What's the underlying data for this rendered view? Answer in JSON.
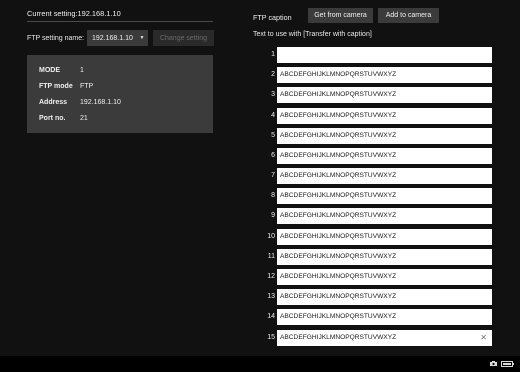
{
  "left_panel": {
    "current_setting": "Current setting:192.168.1.10",
    "setting_label": "FTP setting name:",
    "setting_select": "192.168.1.10",
    "change_button": "Change setting",
    "info": [
      {
        "key": "MODE",
        "value": "1"
      },
      {
        "key": "FTP mode",
        "value": "FTP"
      },
      {
        "key": "Address",
        "value": "192.168.1.10"
      },
      {
        "key": "Port no.",
        "value": "21"
      }
    ]
  },
  "right_panel": {
    "caption_label": "FTP caption",
    "get_button": "Get from camera",
    "add_button": "Add to camera",
    "text_use_label": "Text to use with [Transfer with caption]",
    "captions": [
      {
        "num": "1",
        "value": ""
      },
      {
        "num": "2",
        "value": "ABCDEFGHIJKLMNOPQRSTUVWXYZ"
      },
      {
        "num": "3",
        "value": "ABCDEFGHIJKLMNOPQRSTUVWXYZ"
      },
      {
        "num": "4",
        "value": "ABCDEFGHIJKLMNOPQRSTUVWXYZ"
      },
      {
        "num": "5",
        "value": "ABCDEFGHIJKLMNOPQRSTUVWXYZ"
      },
      {
        "num": "6",
        "value": "ABCDEFGHIJKLMNOPQRSTUVWXYZ"
      },
      {
        "num": "7",
        "value": "ABCDEFGHIJKLMNOPQRSTUVWXYZ"
      },
      {
        "num": "8",
        "value": "ABCDEFGHIJKLMNOPQRSTUVWXYZ"
      },
      {
        "num": "9",
        "value": "ABCDEFGHIJKLMNOPQRSTUVWXYZ"
      },
      {
        "num": "10",
        "value": "ABCDEFGHIJKLMNOPQRSTUVWXYZ"
      },
      {
        "num": "11",
        "value": "ABCDEFGHIJKLMNOPQRSTUVWXYZ"
      },
      {
        "num": "12",
        "value": "ABCDEFGHIJKLMNOPQRSTUVWXYZ"
      },
      {
        "num": "13",
        "value": "ABCDEFGHIJKLMNOPQRSTUVWXYZ"
      },
      {
        "num": "14",
        "value": "ABCDEFGHIJKLMNOPQRSTUVWXYZ"
      },
      {
        "num": "15",
        "value": "ABCDEFGHIJKLMNOPQRSTUVWXYZ"
      }
    ]
  },
  "footer": {
    "icons": [
      "camera-icon",
      "battery-icon"
    ]
  },
  "colors": {
    "background": "#111111",
    "panel": "#3b3b3b",
    "field": "#ffffff"
  }
}
